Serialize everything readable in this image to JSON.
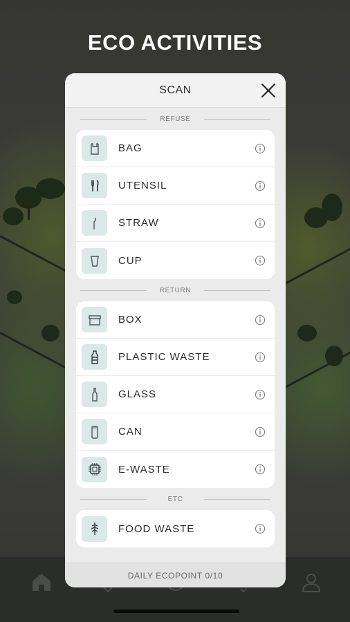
{
  "screen": {
    "title": "ECO ACTIVITIES"
  },
  "modal": {
    "title": "SCAN",
    "sections": [
      {
        "label": "REFUSE",
        "items": [
          {
            "label": "BAG",
            "icon": "bag-icon"
          },
          {
            "label": "UTENSIL",
            "icon": "utensil-icon"
          },
          {
            "label": "STRAW",
            "icon": "straw-icon"
          },
          {
            "label": "CUP",
            "icon": "cup-icon"
          }
        ]
      },
      {
        "label": "RETURN",
        "items": [
          {
            "label": "BOX",
            "icon": "box-icon"
          },
          {
            "label": "PLASTIC WASTE",
            "icon": "plastic-bottle-icon"
          },
          {
            "label": "GLASS",
            "icon": "glass-bottle-icon"
          },
          {
            "label": "CAN",
            "icon": "can-icon"
          },
          {
            "label": "E-WASTE",
            "icon": "chip-icon"
          }
        ]
      },
      {
        "label": "ETC",
        "items": [
          {
            "label": "FOOD WASTE",
            "icon": "food-waste-icon"
          }
        ]
      }
    ],
    "footer": "DAILY ECOPOINT 0/10"
  },
  "tabbar": {
    "icons": [
      "home-icon",
      "nav-icon-2",
      "nav-icon-3",
      "nav-icon-4",
      "profile-icon"
    ]
  },
  "colors": {
    "icon_tile": "#dbe8e8",
    "icon_stroke": "#4a5a5a",
    "overlay_bg": "#3b3b36"
  }
}
